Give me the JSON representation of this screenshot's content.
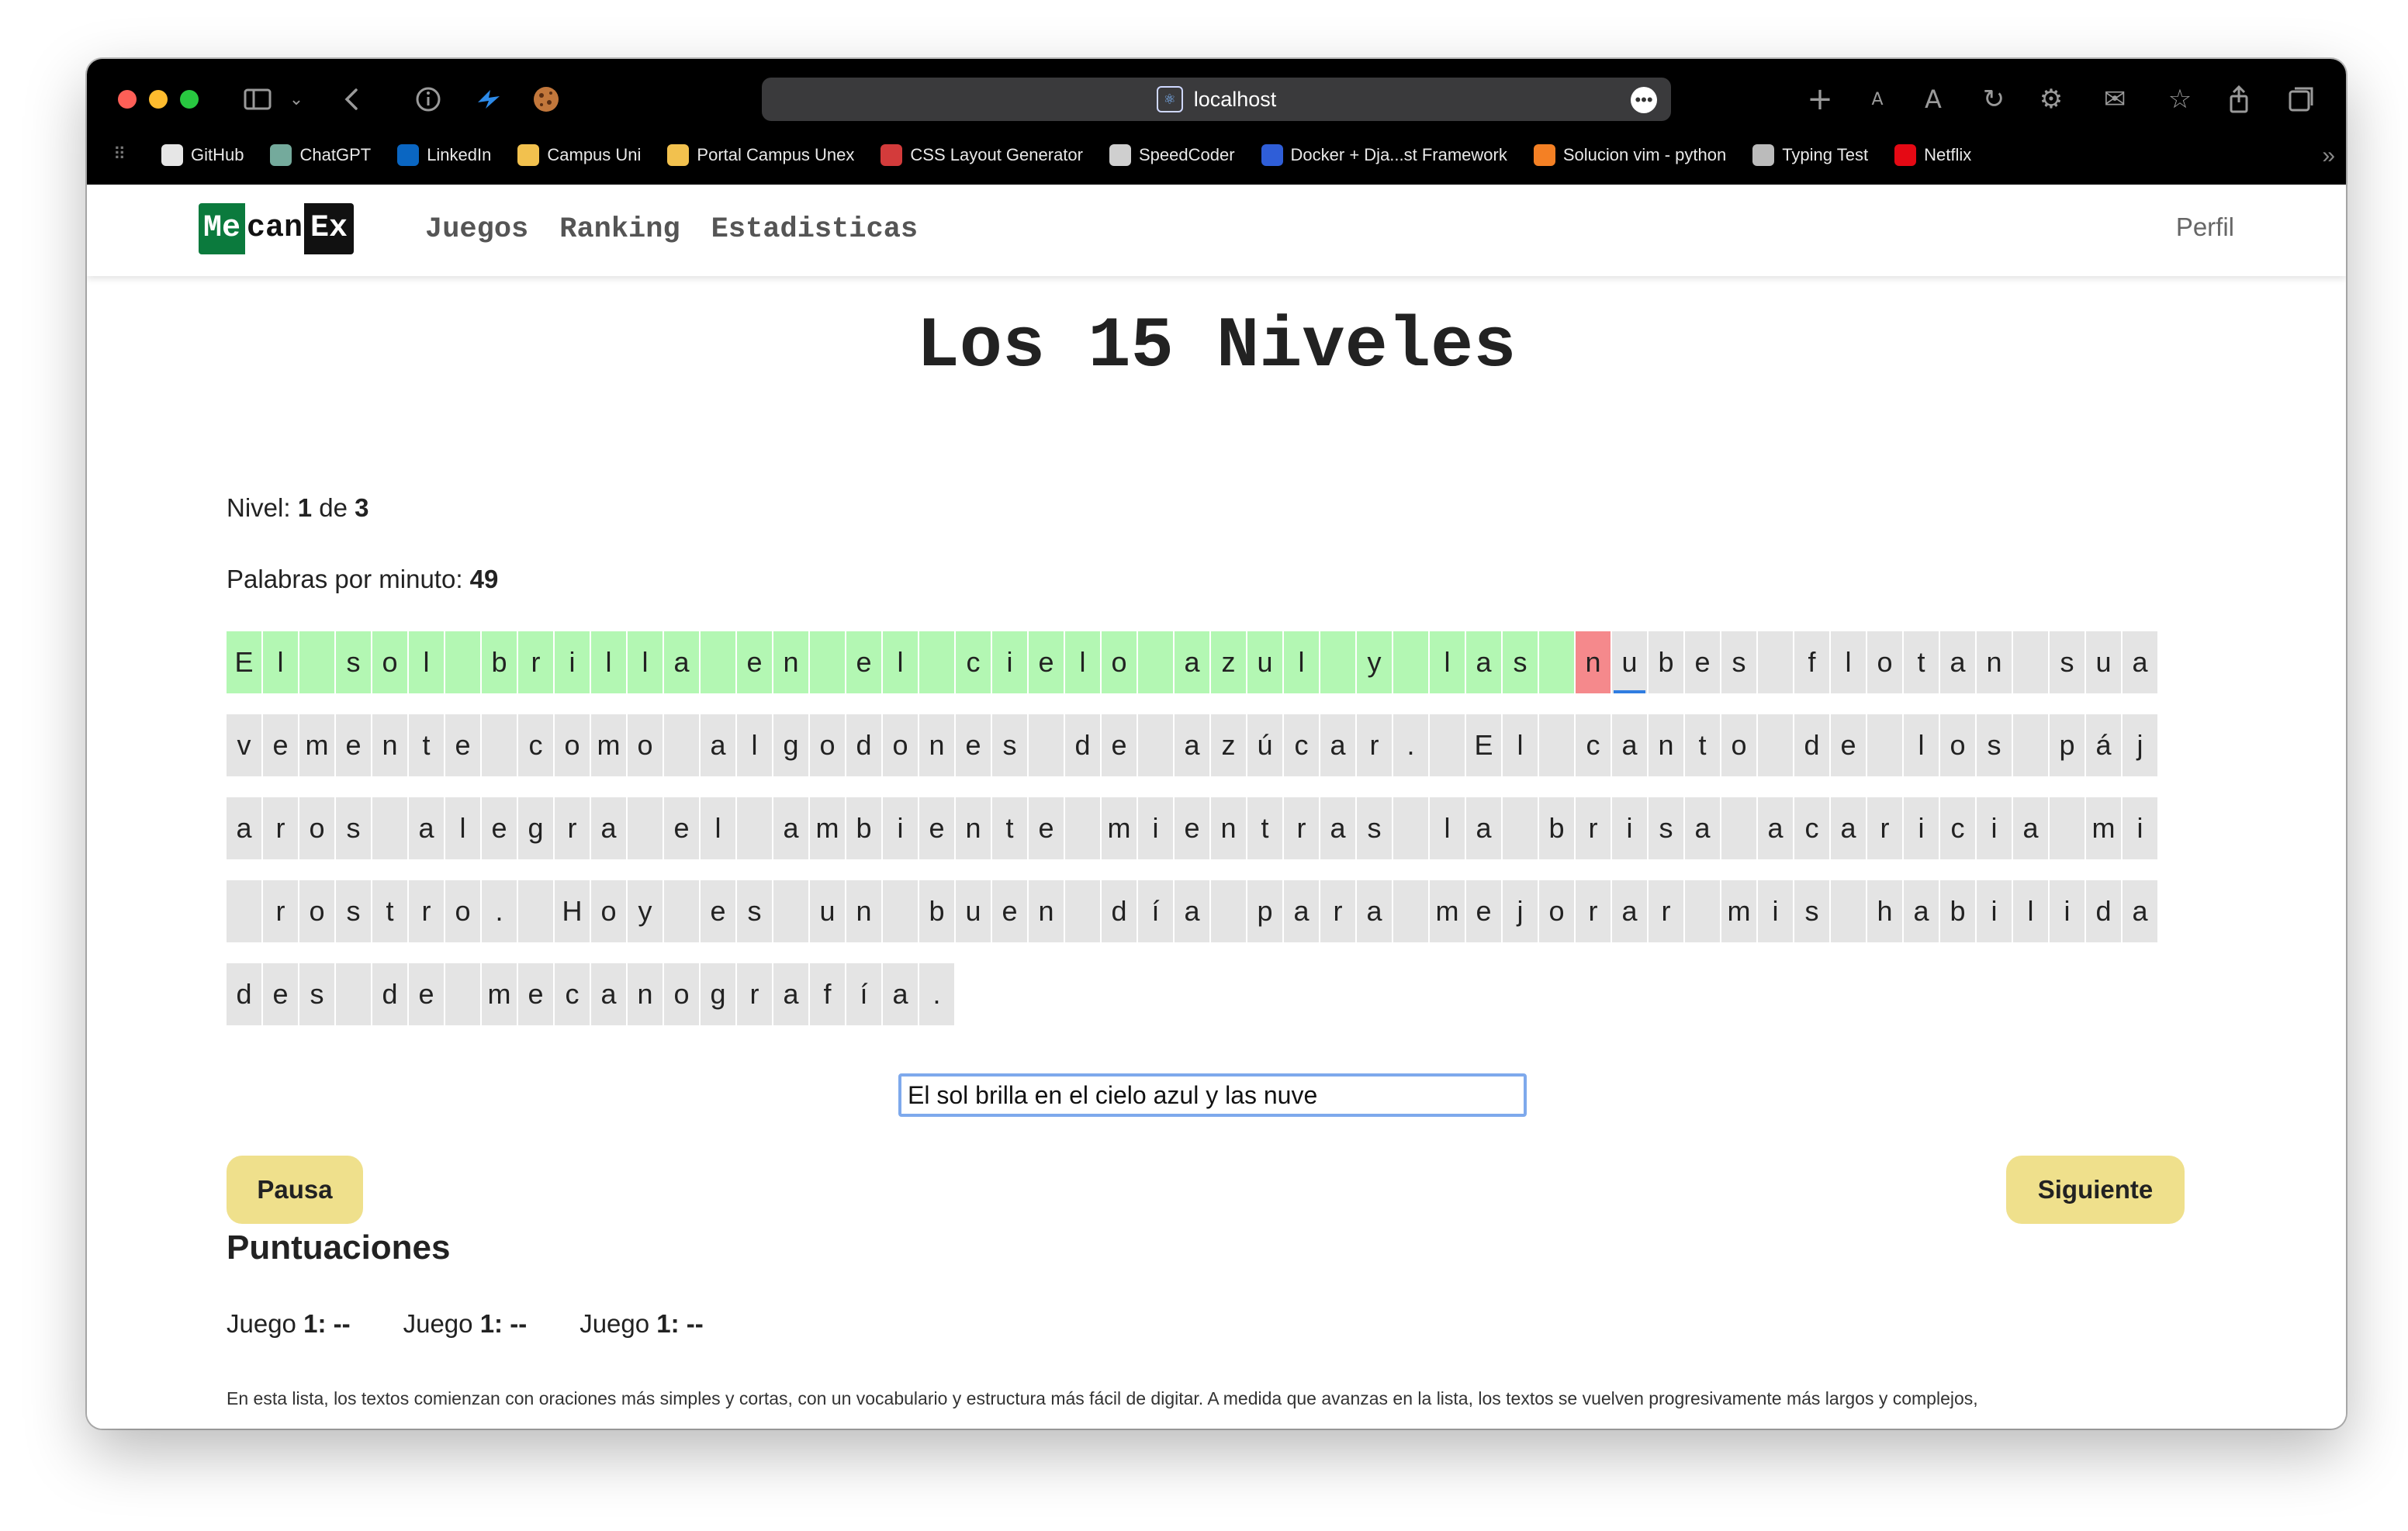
{
  "browser": {
    "url": "localhost",
    "bookmarks": [
      {
        "label": "GitHub",
        "icon": "github-icon",
        "color": "#e6e6e6"
      },
      {
        "label": "ChatGPT",
        "icon": "chatgpt-icon",
        "color": "#74aa9c"
      },
      {
        "label": "LinkedIn",
        "icon": "linkedin-icon",
        "color": "#0a66c2"
      },
      {
        "label": "Campus Uni",
        "icon": "campus-icon",
        "color": "#f2c14e"
      },
      {
        "label": "Portal Campus Unex",
        "icon": "campus-icon",
        "color": "#f2c14e"
      },
      {
        "label": "CSS Layout Generator",
        "icon": "grid-icon",
        "color": "#d33b3b"
      },
      {
        "label": "SpeedCoder",
        "icon": "bolt-icon",
        "color": "#cfcfcf"
      },
      {
        "label": "Docker + Dja...st Framework",
        "icon": "docker-icon",
        "color": "#2f5ed8"
      },
      {
        "label": "Solucion vim - python",
        "icon": "stack-icon",
        "color": "#f48024"
      },
      {
        "label": "Typing Test",
        "icon": "typewriter-icon",
        "color": "#bbbbbb"
      },
      {
        "label": "Netflix",
        "icon": "netflix-icon",
        "color": "#e50914"
      }
    ]
  },
  "nav": {
    "logo": [
      "Me",
      "can",
      "Ex"
    ],
    "links": [
      "Juegos",
      "Ranking",
      "Estadisticas"
    ],
    "profile": "Perfil"
  },
  "main": {
    "title": "Los 15 Niveles",
    "level_label": "Nivel: ",
    "level_current": "1",
    "level_of": " de ",
    "level_total": "3",
    "wpm_label": "Palabras por minuto: ",
    "wpm_value": "49",
    "text_lines": [
      "El sol brilla en el cielo azul y las nubes flotan sua",
      "vemente como algodones de azúcar. El canto de los páj",
      "aros alegra el ambiente mientras la brisa acaricia mi",
      " rostro. Hoy es un buen día para mejorar mis habilida",
      "des de mecanografía."
    ],
    "typed_count": 38,
    "error_indices": [
      37
    ],
    "typed_value": "El sol brilla en el cielo azul y las nuve",
    "pause_button": "Pausa",
    "next_button": "Siguiente",
    "scores_title": "Puntuaciones",
    "scores": [
      {
        "label": "Juego ",
        "num": "1",
        "value": ": --"
      },
      {
        "label": "Juego ",
        "num": "1",
        "value": ": --"
      },
      {
        "label": "Juego ",
        "num": "1",
        "value": ": --"
      }
    ],
    "description": "En esta lista, los textos comienzan con oraciones más simples y cortas, con un vocabulario y estructura más fácil de digitar. A medida que avanzas en la lista, los textos se vuelven progresivamente más largos y complejos,"
  },
  "colors": {
    "correct": "#b3f7b3",
    "error": "#f5898c",
    "pending": "#e4e4e4",
    "button": "#efe08c",
    "logo_green": "#0b7a3d"
  }
}
